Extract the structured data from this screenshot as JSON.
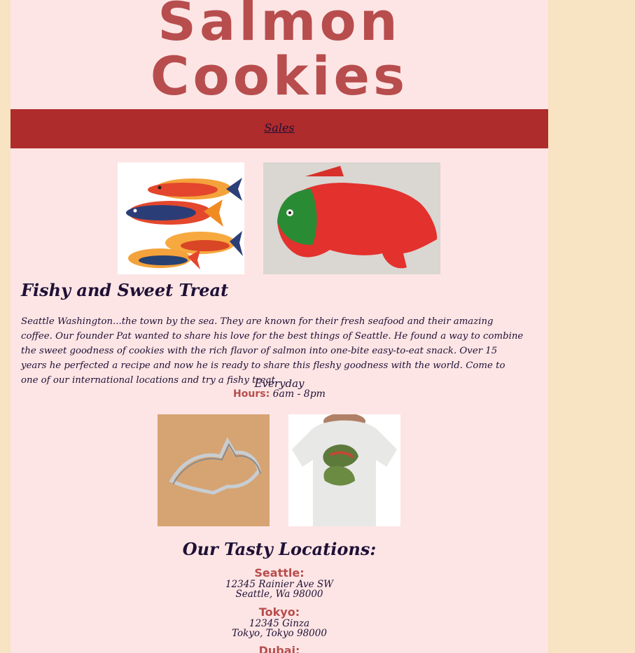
{
  "header": {
    "title_line1": "Salmon",
    "title_line2": "Cookies"
  },
  "nav": {
    "sales_link": "Sales"
  },
  "about": {
    "heading": "Fishy and Sweet Treat",
    "text": "Seattle Washington...the town by the sea. They are known for their fresh seafood and their amazing coffee. Our founder Pat wanted to share his love for the best things of Seattle. He found a way to combine the sweet goodness of cookies with the rich flavor of salmon into one-bite easy-to-eat snack. Over 15 years he perfected a recipe and now he is ready to share this fleshy goodness with the world. Come to one of our international locations and try a fishy treat."
  },
  "hours": {
    "everyday": "Everyday",
    "label": "Hours:",
    "value": "6am - 8pm"
  },
  "locations": {
    "heading": "Our Tasty Locations:",
    "items": [
      {
        "name": "Seattle:",
        "line1": "12345 Rainier Ave SW",
        "line2": "Seattle, Wa 98000"
      },
      {
        "name": "Tokyo:",
        "line1": "12345 Ginza",
        "line2": "Tokyo, Tokyo 98000"
      },
      {
        "name": "Dubai:",
        "line1": "",
        "line2": ""
      }
    ]
  },
  "colors": {
    "background": "#f8e3c2",
    "panel": "#fde5e5",
    "nav": "#af2c2c",
    "accent": "#b84d4d",
    "text": "#1f1036"
  }
}
